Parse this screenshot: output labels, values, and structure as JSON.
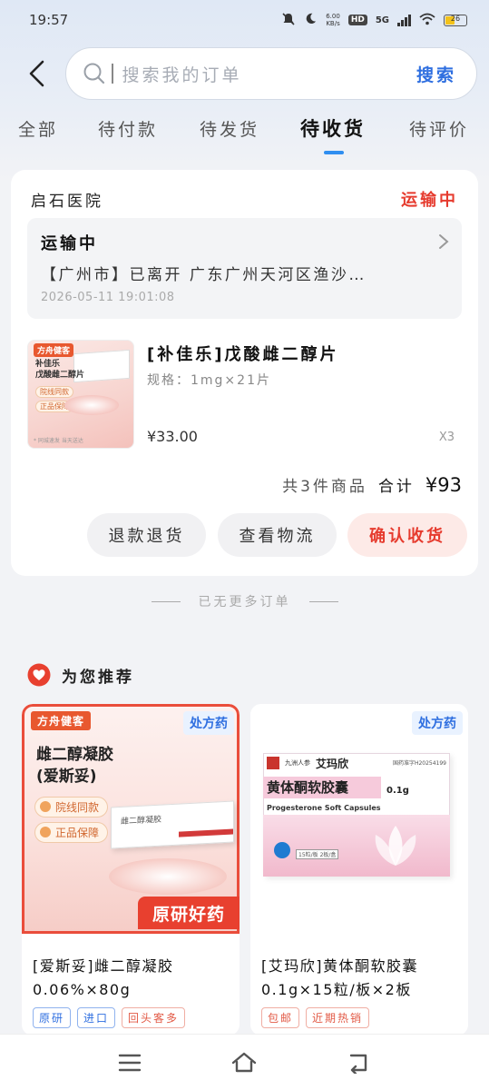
{
  "status_bar": {
    "time": "19:57",
    "net_speed_value": "6.00",
    "net_speed_unit": "KB/s",
    "hd": "HD",
    "network": "5G",
    "battery_level": "26",
    "icons": [
      "mute-icon",
      "moon-icon",
      "signal-icon",
      "wifi-icon",
      "battery-icon"
    ]
  },
  "search": {
    "placeholder": "搜索我的订单",
    "submit_label": "搜索"
  },
  "tabs": [
    {
      "label": "全部",
      "active": false
    },
    {
      "label": "待付款",
      "active": false
    },
    {
      "label": "待发货",
      "active": false
    },
    {
      "label": "待收货",
      "active": true
    },
    {
      "label": "待评价",
      "active": false
    }
  ],
  "order": {
    "shop_name": "启石医院",
    "status": "运输中",
    "logistics": {
      "status": "运输中",
      "detail": "【广州市】已离开 广东广州天河区渔沙…",
      "time": "2026-05-11 19:01:08"
    },
    "product": {
      "name": "[补佳乐]戊酸雌二醇片",
      "spec": "规格：1mg×21片",
      "price": "¥33.00",
      "quantity": "X3",
      "thumb": {
        "logo": "方舟健客",
        "title_line1": "补佳乐",
        "title_line2": "戊酸雌二醇片",
        "tag1": "院线同款",
        "tag2": "正品保障",
        "footer": "* 同城速发 当天送达"
      }
    },
    "summary": {
      "count_text": "共3件商品",
      "total_label": "合计",
      "total_amount": "¥93"
    },
    "actions": {
      "refund": "退款退货",
      "logistics": "查看物流",
      "confirm": "确认收货"
    }
  },
  "no_more_text": "已无更多订单",
  "recommend": {
    "title": "为您推荐",
    "items": [
      {
        "badge": "处方药",
        "name": "[爱斯妥]雌二醇凝胶0.06%×80g",
        "tags": [
          {
            "label": "原研",
            "color": "blue"
          },
          {
            "label": "进口",
            "color": "blue"
          },
          {
            "label": "回头客多",
            "color": "red"
          }
        ],
        "image": {
          "logo": "方舟健客",
          "title_line1": "雌二醇凝胶",
          "title_line2": "(爱斯妥)",
          "pill1": "院线同款",
          "pill2": "正品保障",
          "box_label": "雌二醇凝胶",
          "banner": "原研好药"
        }
      },
      {
        "badge": "处方药",
        "name": "[艾玛欣]黄体酮软胶囊0.1g×15粒/板×2板",
        "tags": [
          {
            "label": "包邮",
            "color": "red"
          },
          {
            "label": "近期热销",
            "color": "red"
          }
        ],
        "image": {
          "brand_small": "九洲人参",
          "brand": "艾玛欣",
          "reg": "国药准字H20254199",
          "product": "黄体酮软胶囊",
          "dose": "0.1g",
          "english": "Progesterone Soft Capsules",
          "pack": "15粒/板 2板/盒"
        }
      }
    ]
  },
  "bottom_nav": [
    "menu-icon",
    "home-icon",
    "back-icon"
  ],
  "colors": {
    "accent_blue": "#2f6fe0",
    "status_red": "#e63b2e",
    "tab_indicator": "#2f8ef0"
  }
}
